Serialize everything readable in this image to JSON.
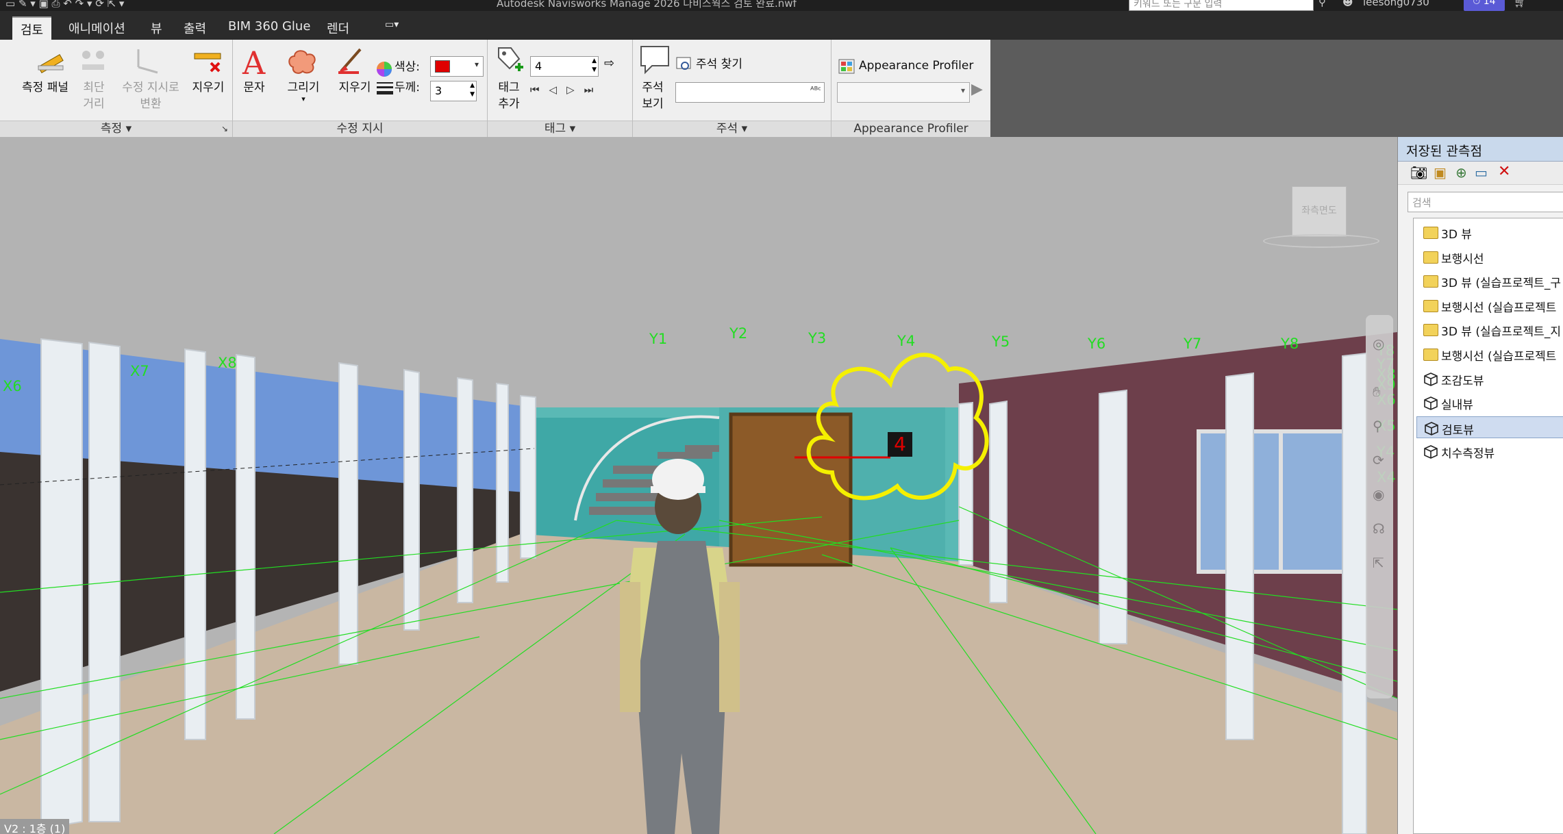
{
  "titlebar": {
    "title": "Autodesk Navisworks Manage 2026    나비스웍스 검토 완료.nwf",
    "keyword_placeholder": "키워드 또는 구문 입력",
    "user": "leesong0730",
    "badge": "14"
  },
  "tabs": [
    {
      "label": "검토",
      "active": true
    },
    {
      "label": "애니메이션"
    },
    {
      "label": "뷰"
    },
    {
      "label": "출력"
    },
    {
      "label": "BIM 360 Glue"
    },
    {
      "label": "렌더"
    }
  ],
  "ribbon": {
    "measure": {
      "title": "측정",
      "panel_button": "측정 패널",
      "shortest_distance_1": "최단",
      "shortest_distance_2": "거리",
      "convert_markup_1": "수정 지시로",
      "convert_markup_2": "변환",
      "clear": "지우기"
    },
    "redline": {
      "title": "수정 지시",
      "text": "문자",
      "draw": "그리기",
      "erase": "지우기",
      "color_label": "색상:",
      "color_value": "#e00000",
      "thickness_label": "두께:",
      "thickness_value": "3"
    },
    "tags": {
      "title": "태그",
      "add_tag_1": "태그",
      "add_tag_2": "추가",
      "tag_id_value": "4"
    },
    "comments": {
      "title": "주석",
      "view_comments_1": "주석",
      "view_comments_2": "보기",
      "find_comments": "주석 찾기"
    },
    "appearance": {
      "title": "Appearance Profiler",
      "button": "Appearance Profiler"
    }
  },
  "viewport": {
    "viewcube_label": "좌측면도",
    "status_text": "V2 : 1층 (1)",
    "tag_number": "4",
    "grid_labels": [
      "X6",
      "X7",
      "X8",
      "Y1",
      "Y2",
      "Y3",
      "Y4",
      "Y5",
      "Y6",
      "Y7",
      "Y8",
      "Y8",
      "Y7",
      "X8",
      "X9",
      "X6",
      "X5",
      "Y4",
      "X4"
    ],
    "cloud_color": "#f5f000",
    "grid_color": "#22dd22"
  },
  "saved_viewpoints": {
    "title": "저장된 관측점",
    "search_placeholder": "검색",
    "items": [
      {
        "label": "3D 뷰",
        "type": "folder"
      },
      {
        "label": "보행시선",
        "type": "folder"
      },
      {
        "label": "3D 뷰 (실습프로젝트_구",
        "type": "folder"
      },
      {
        "label": "보행시선 (실습프로젝트",
        "type": "folder"
      },
      {
        "label": "3D 뷰 (실습프로젝트_지",
        "type": "folder"
      },
      {
        "label": "보행시선 (실습프로젝트",
        "type": "folder"
      },
      {
        "label": "조감도뷰",
        "type": "view"
      },
      {
        "label": "실내뷰",
        "type": "view"
      },
      {
        "label": "검토뷰",
        "type": "view",
        "selected": true
      },
      {
        "label": "치수측정뷰",
        "type": "view"
      }
    ]
  }
}
